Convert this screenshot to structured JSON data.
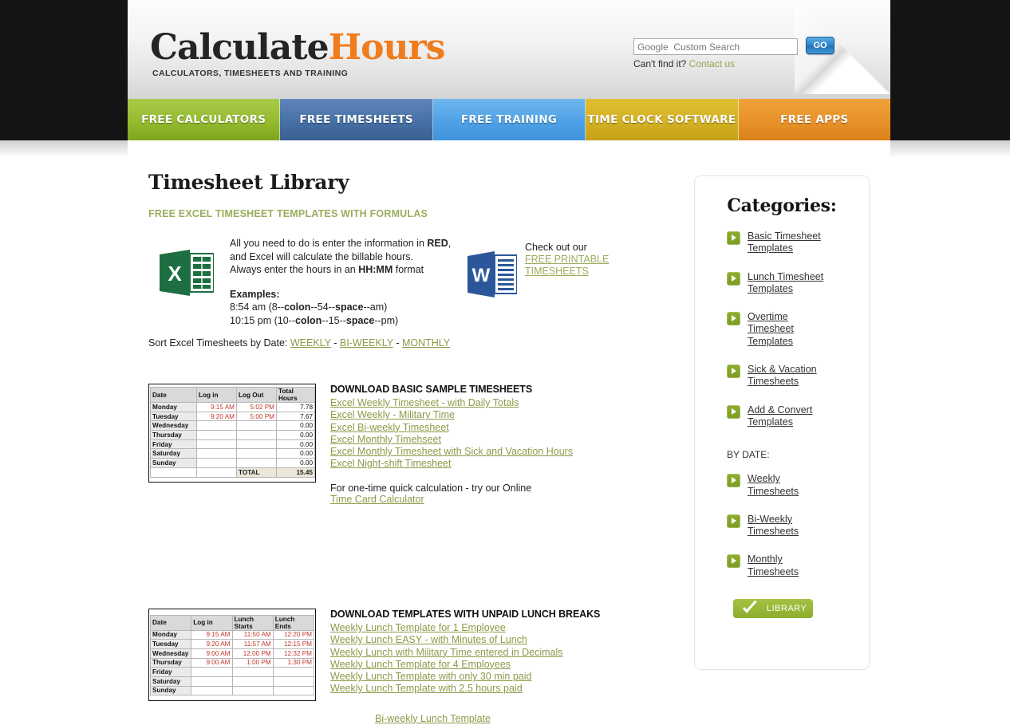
{
  "header": {
    "logo_part1": "Calculate",
    "logo_part2": "Hours",
    "tagline": "CALCULATORS, TIMESHEETS AND TRAINING",
    "search_placeholder": "Google  Custom Search",
    "search_value": "",
    "go_label": "GO",
    "cant_find": "Can't find it? ",
    "contact_label": "Contact us"
  },
  "nav": {
    "items": [
      {
        "label": "FREE CALCULATORS"
      },
      {
        "label": "FREE TIMESHEETS"
      },
      {
        "label": "FREE TRAINING"
      },
      {
        "label": "TIME CLOCK SOFTWARE"
      },
      {
        "label": "FREE APPS"
      }
    ]
  },
  "main": {
    "title": "Timesheet Library",
    "subhead": "FREE EXCEL TIMESHEET TEMPLATES WITH FORMULAS",
    "intro": {
      "line1_a": "All you need to do is enter the information in ",
      "line1_b": "RED",
      "line1_c": ",",
      "line2": "and Excel will calculate the billable hours.",
      "line3_a": "Always enter the hours in an ",
      "line3_b": "HH:MM",
      "line3_c": " format",
      "examples_label": "Examples:",
      "example1_a": "8:54 am (8--",
      "example1_b": "colon",
      "example1_c": "--54--",
      "example1_d": "space",
      "example1_e": "--am)",
      "example2_a": "10:15 pm (10--",
      "example2_b": "colon",
      "example2_c": "--15--",
      "example2_d": "space",
      "example2_e": "--pm)"
    },
    "word_block": {
      "check_out": "Check out our",
      "link_line1": "FREE PRINTABLE",
      "link_line2": "TIMESHEETS"
    },
    "sort_line": {
      "label": "Sort Excel Timesheets by Date: ",
      "weekly": "WEEKLY",
      "sep1": " - ",
      "biweekly": "BI-WEEKLY",
      "sep2": " - ",
      "monthly": "MONTHLY"
    },
    "section1": {
      "table": {
        "headers": [
          "Date",
          "Log in",
          "Log Out",
          "Total Hours"
        ],
        "rows": [
          {
            "day": "Monday",
            "in": "9:15 AM",
            "out": "5:02 PM",
            "total": "7.78"
          },
          {
            "day": "Tuesday",
            "in": "9:20 AM",
            "out": "5:00 PM",
            "total": "7.67"
          },
          {
            "day": "Wednesday",
            "in": "",
            "out": "",
            "total": "0.00"
          },
          {
            "day": "Thursday",
            "in": "",
            "out": "",
            "total": "0.00"
          },
          {
            "day": "Friday",
            "in": "",
            "out": "",
            "total": "0.00"
          },
          {
            "day": "Saturday",
            "in": "",
            "out": "",
            "total": "0.00"
          },
          {
            "day": "Sunday",
            "in": "",
            "out": "",
            "total": "0.00"
          }
        ],
        "total_label": "TOTAL",
        "total_value": "15.45"
      },
      "links_title": "DOWNLOAD BASIC SAMPLE TIMESHEETS",
      "links": [
        "Excel Weekly Timesheet - with Daily Totals",
        "Excel Weekly - Military Time",
        "Excel Bi-weekly Timesheet",
        "Excel Monthly Timehseet",
        "Excel Monthly Timesheet with Sick and Vacation Hours",
        "Excel Night-shift Timesheet"
      ],
      "after_text": "For one-time quick calculation - try our Online ",
      "after_link": "Time Card Calculator"
    },
    "section2": {
      "table": {
        "headers": [
          "Date",
          "Log in",
          "Lunch Starts",
          "Lunch Ends"
        ],
        "rows": [
          {
            "day": "Monday",
            "in": "9:15 AM",
            "ls": "11:50 AM",
            "le": "12:20 PM"
          },
          {
            "day": "Tuesday",
            "in": "9:20 AM",
            "ls": "11:57 AM",
            "le": "12:15 PM"
          },
          {
            "day": "Wednesday",
            "in": "9:00 AM",
            "ls": "12:00 PM",
            "le": "12:32 PM"
          },
          {
            "day": "Thursday",
            "in": "9:00 AM",
            "ls": "1:00 PM",
            "le": "1:30 PM"
          },
          {
            "day": "Friday",
            "in": "",
            "ls": "",
            "le": ""
          },
          {
            "day": "Saturday",
            "in": "",
            "ls": "",
            "le": ""
          },
          {
            "day": "Sunday",
            "in": "",
            "ls": "",
            "le": ""
          }
        ]
      },
      "links_title": "DOWNLOAD TEMPLATES WITH UNPAID LUNCH BREAKS",
      "links": [
        "Weekly Lunch Template for 1 Employee",
        "Weekly Lunch EASY - with Minutes of Lunch",
        "Weekly Lunch with Military Time entered in Decimals",
        "Weekly Lunch Template for 4 Employees",
        "Weekly Lunch Template with only 30 min paid",
        "Weekly Lunch Template with 2.5 hours paid"
      ],
      "centered_links": [
        "Bi-weekly Lunch Template"
      ]
    }
  },
  "sidebar": {
    "title": "Categories:",
    "categories": [
      {
        "label": "Basic Timesheet Templates"
      },
      {
        "label": "Lunch Timesheet Templates"
      },
      {
        "label": "Overtime Timesheet Templates"
      },
      {
        "label": "Sick & Vacation Timesheets"
      },
      {
        "label": "Add & Convert Templates"
      }
    ],
    "by_date_label": "BY DATE:",
    "by_date": [
      {
        "label": "Weekly Timesheets"
      },
      {
        "label": "Bi-Weekly Timesheets"
      },
      {
        "label": "Monthly Timesheets"
      }
    ],
    "library_button": "LIBRARY"
  },
  "colors": {
    "brand_orange": "#ef7c1d",
    "brand_green": "#8fb233",
    "link_green": "#8a9c48",
    "nav_green": "#94bb2e",
    "nav_blue": "#4670a6",
    "nav_lightblue": "#4ea1e6",
    "nav_gold": "#d4b124",
    "nav_orange": "#e8912a",
    "table_red": "#c0392b"
  }
}
